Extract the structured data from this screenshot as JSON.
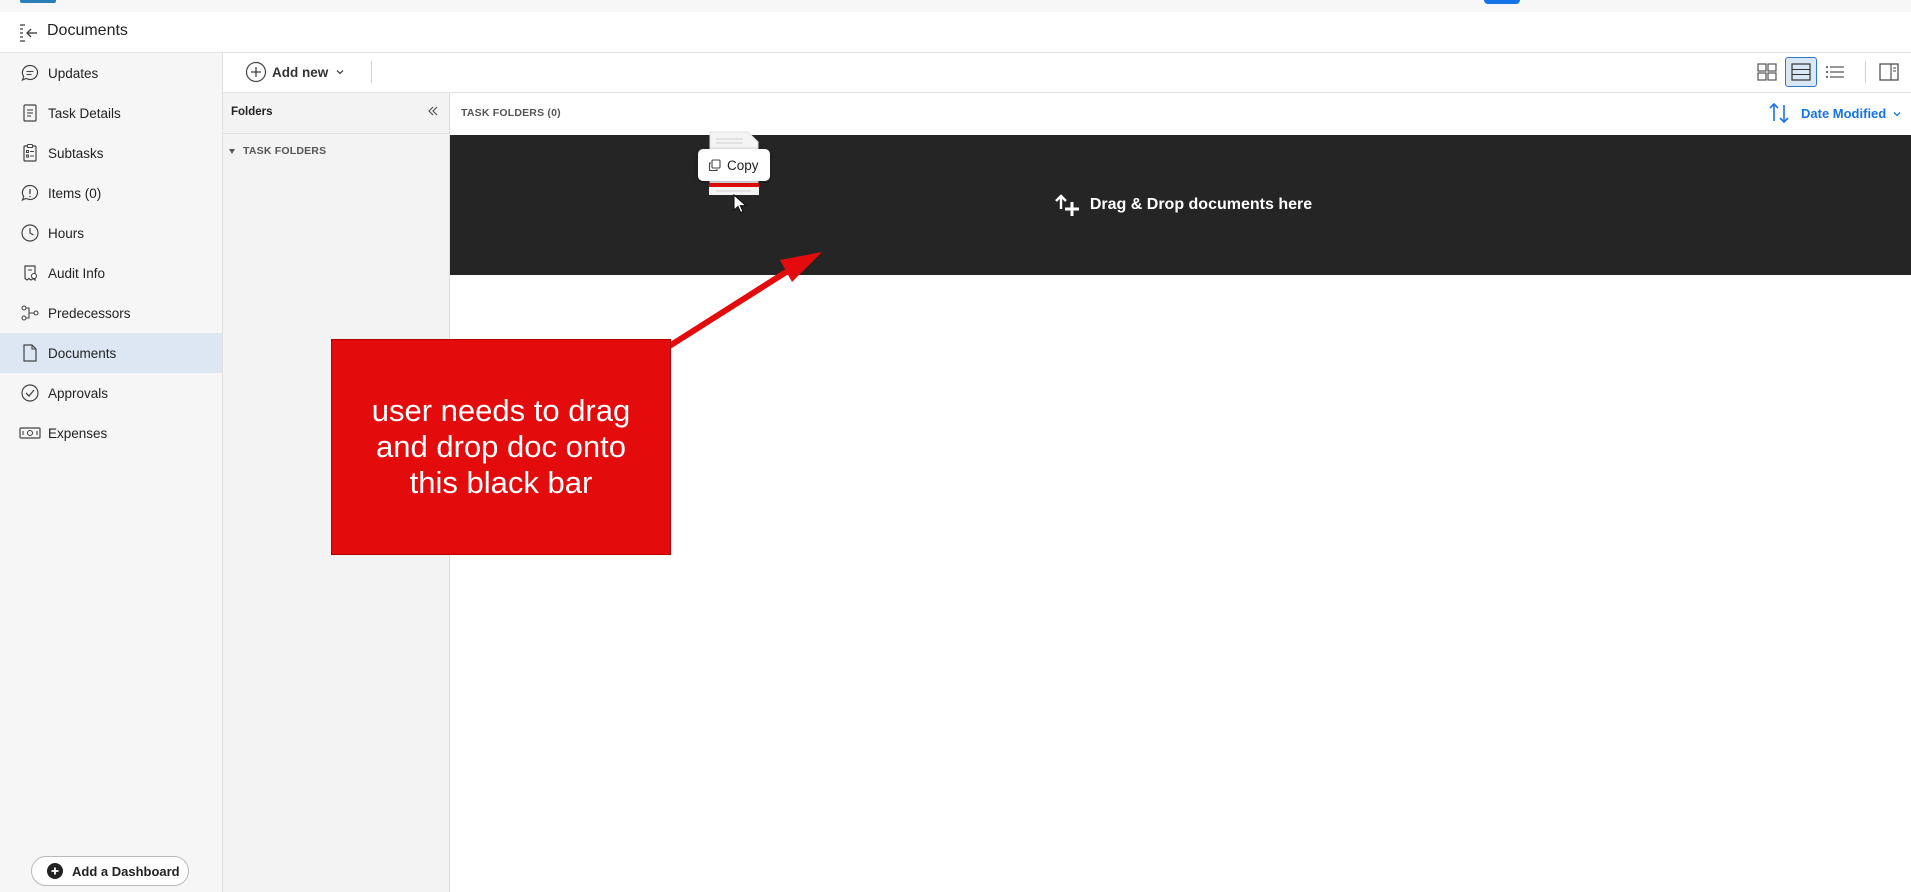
{
  "header": {
    "title": "Documents"
  },
  "sidebar": {
    "items": [
      {
        "label": "Updates",
        "icon": "chat-bubble-icon"
      },
      {
        "label": "Task Details",
        "icon": "document-icon"
      },
      {
        "label": "Subtasks",
        "icon": "clipboard-list-icon"
      },
      {
        "label": "Items (0)",
        "icon": "alert-bubble-icon"
      },
      {
        "label": "Hours",
        "icon": "clock-icon"
      },
      {
        "label": "Audit Info",
        "icon": "audit-icon"
      },
      {
        "label": "Predecessors",
        "icon": "predecessors-icon"
      },
      {
        "label": "Documents",
        "icon": "document-icon",
        "active": true
      },
      {
        "label": "Approvals",
        "icon": "check-circle-icon"
      },
      {
        "label": "Expenses",
        "icon": "money-icon"
      }
    ],
    "add_dashboard": "Add a Dashboard"
  },
  "toolbar": {
    "add_new": "Add new",
    "views": [
      "grid-view-icon",
      "card-view-icon",
      "list-view-icon",
      "side-panel-icon"
    ],
    "selected_view": "card-view-icon"
  },
  "folders": {
    "title": "Folders",
    "tree": [
      {
        "label": "TASK FOLDERS",
        "expanded": true
      }
    ]
  },
  "content": {
    "folder_count": "TASK FOLDERS (0)",
    "sort_label": "Date Modified",
    "drop_text": "Drag & Drop documents here"
  },
  "drag": {
    "tooltip": "Copy"
  },
  "annotation": {
    "text": "user needs to drag and drop doc onto this black bar",
    "color": "#e30b0b"
  },
  "colors": {
    "accent": "#1473e6",
    "active_nav": "#dde7f3",
    "dropbar": "#252525"
  }
}
